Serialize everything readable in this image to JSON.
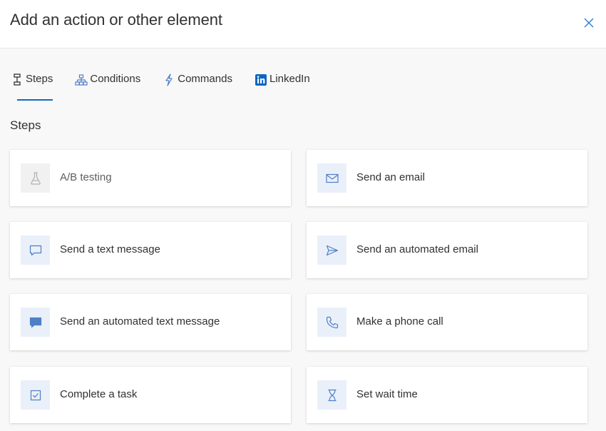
{
  "dialog": {
    "title": "Add an action or other element"
  },
  "tabs": [
    {
      "label": "Steps",
      "icon": "steps-icon",
      "active": true
    },
    {
      "label": "Conditions",
      "icon": "conditions-icon",
      "active": false
    },
    {
      "label": "Commands",
      "icon": "lightning-icon",
      "active": false
    },
    {
      "label": "LinkedIn",
      "icon": "linkedin-icon",
      "active": false
    }
  ],
  "section": {
    "label": "Steps"
  },
  "cards": [
    {
      "label": "A/B testing",
      "icon": "flask-icon",
      "disabled": true
    },
    {
      "label": "Send an email",
      "icon": "mail-icon",
      "disabled": false
    },
    {
      "label": "Send a text message",
      "icon": "chat-bubble-icon",
      "disabled": false
    },
    {
      "label": "Send an automated email",
      "icon": "send-icon",
      "disabled": false
    },
    {
      "label": "Send an automated text message",
      "icon": "filled-chat-icon",
      "disabled": false
    },
    {
      "label": "Make a phone call",
      "icon": "phone-icon",
      "disabled": false
    },
    {
      "label": "Complete a task",
      "icon": "checkbox-icon",
      "disabled": false
    },
    {
      "label": "Set wait time",
      "icon": "hourglass-icon",
      "disabled": false
    }
  ],
  "colors": {
    "accent": "#0f6cbd",
    "icon": "#4f7fc6",
    "linkedin": "#0a66c2"
  }
}
